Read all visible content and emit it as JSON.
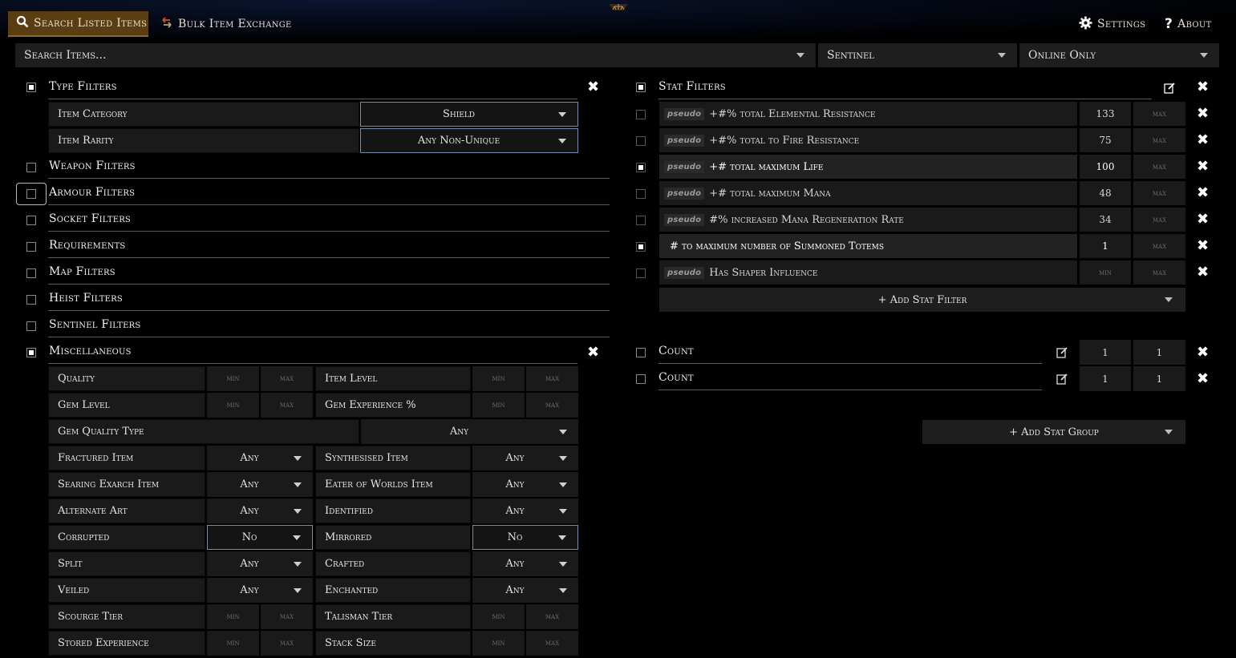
{
  "tabs": {
    "search": "Search Listed Items",
    "bulk": "Bulk Item Exchange",
    "settings": "Settings",
    "about": "About"
  },
  "search": {
    "placeholder": "Search Items...",
    "league": "Sentinel",
    "status": "Online Only"
  },
  "left": {
    "type_filters": {
      "title": "Type Filters",
      "item_category_label": "Item Category",
      "item_category_value": "Shield",
      "item_rarity_label": "Item Rarity",
      "item_rarity_value": "Any Non-Unique"
    },
    "groups": [
      "Weapon Filters",
      "Armour Filters",
      "Socket Filters",
      "Requirements",
      "Map Filters",
      "Heist Filters",
      "Sentinel Filters"
    ],
    "misc": {
      "title": "Miscellaneous",
      "quality": "Quality",
      "item_level": "Item Level",
      "gem_level": "Gem Level",
      "gem_experience": "Gem Experience %",
      "gem_quality_type": "Gem Quality Type",
      "gem_quality_type_value": "Any",
      "fractured": "Fractured Item",
      "synthesised": "Synthesised Item",
      "searing": "Searing Exarch Item",
      "eater": "Eater of Worlds Item",
      "alt_art": "Alternate Art",
      "identified": "Identified",
      "corrupted": "Corrupted",
      "mirrored": "Mirrored",
      "split": "Split",
      "crafted": "Crafted",
      "veiled": "Veiled",
      "enchanted": "Enchanted",
      "scourge": "Scourge Tier",
      "talisman": "Talisman Tier",
      "stored_exp": "Stored Experience",
      "stack_size": "Stack Size",
      "any": "Any",
      "no": "No",
      "min": "min",
      "max": "max"
    }
  },
  "right": {
    "stat_filters_title": "Stat Filters",
    "stats": [
      {
        "tag": "pseudo",
        "text": "+#% total Elemental Resistance",
        "min": "133",
        "max": "max",
        "checked": false
      },
      {
        "tag": "pseudo",
        "text": "+#% total to Fire Resistance",
        "min": "75",
        "max": "max",
        "checked": false
      },
      {
        "tag": "pseudo",
        "text": "+# total maximum Life",
        "min": "100",
        "max": "max",
        "checked": true
      },
      {
        "tag": "pseudo",
        "text": "+# total maximum Mana",
        "min": "48",
        "max": "max",
        "checked": false
      },
      {
        "tag": "pseudo",
        "text": "#% increased Mana Regeneration Rate",
        "min": "34",
        "max": "max",
        "checked": false
      },
      {
        "tag": "",
        "text": "# to maximum number of Summoned Totems",
        "min": "1",
        "max": "max",
        "checked": true
      },
      {
        "tag": "pseudo",
        "text": "Has Shaper Influence",
        "min": "min",
        "max": "max",
        "checked": false
      }
    ],
    "add_stat_filter": "+ Add Stat Filter",
    "counts": [
      {
        "label": "Count",
        "min": "1",
        "max": "1"
      },
      {
        "label": "Count",
        "min": "1",
        "max": "1"
      }
    ],
    "add_stat_group": "+ Add Stat Group"
  },
  "colors": {
    "accent_tab": "#5b3d12",
    "panel": "#1a1a1a",
    "highlight_border": "#7a8aa8"
  }
}
